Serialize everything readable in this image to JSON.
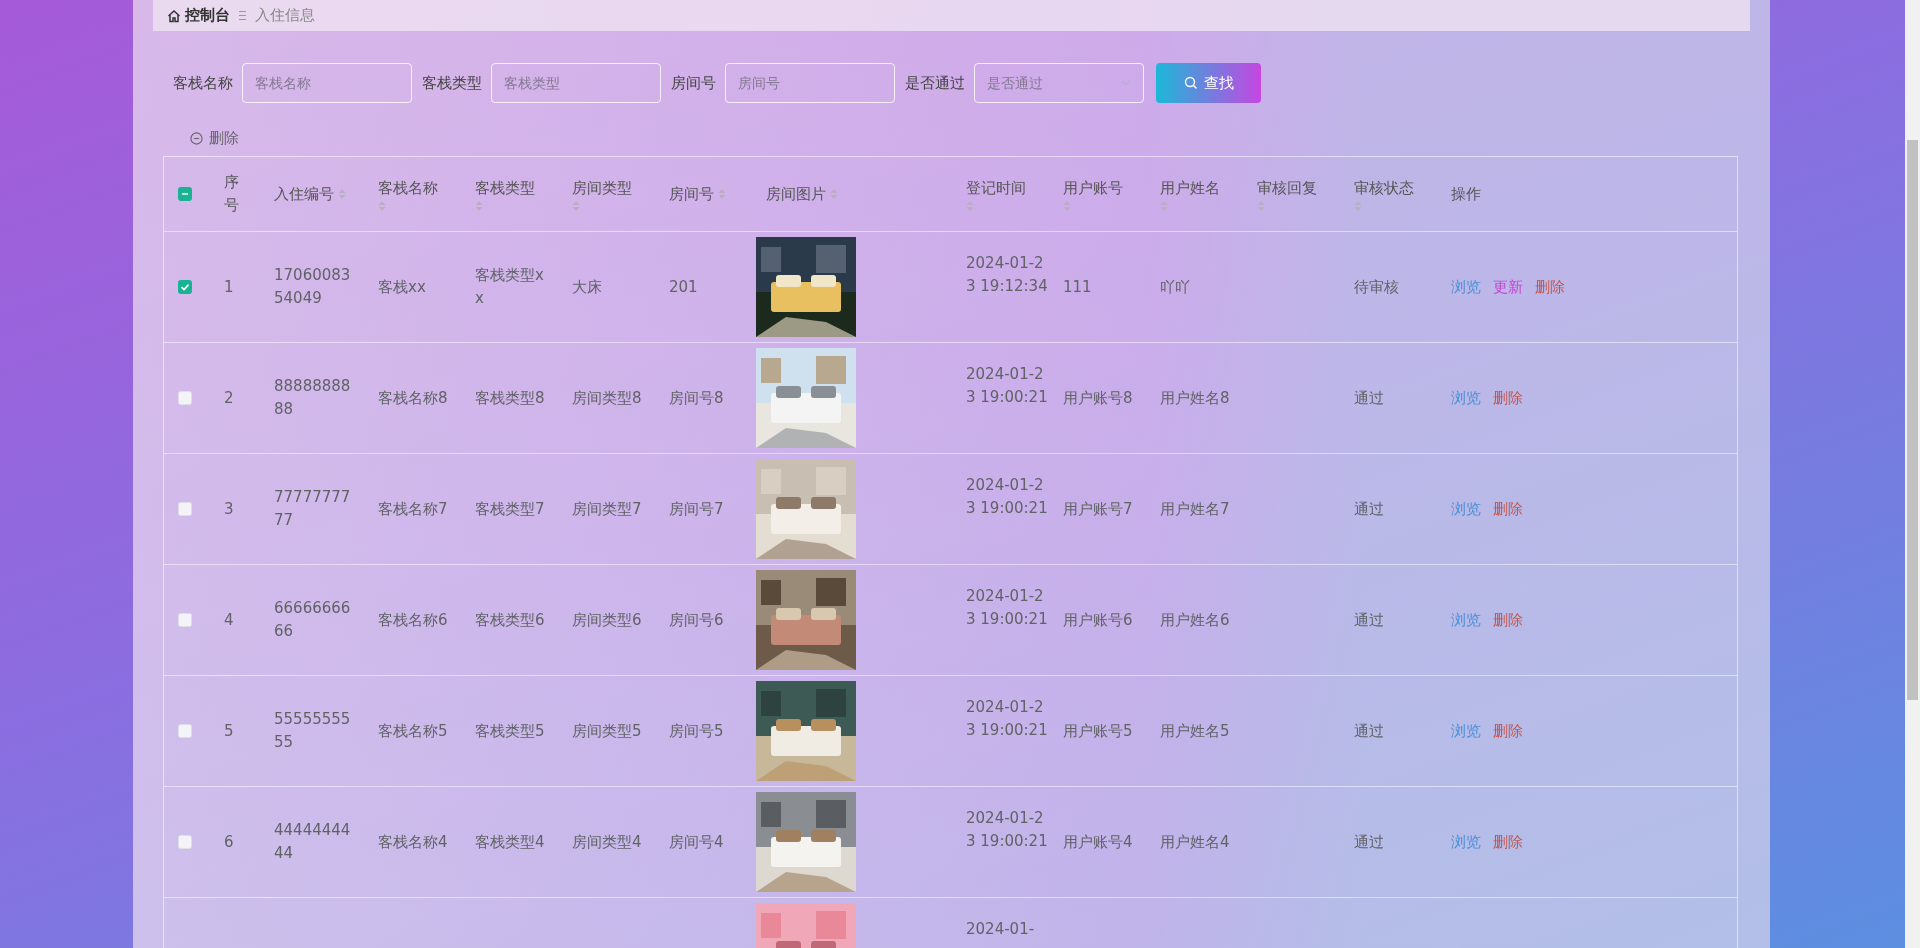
{
  "breadcrumb": {
    "home": "控制台",
    "current": "入住信息"
  },
  "filters": [
    {
      "label": "客栈名称",
      "placeholder": "客栈名称",
      "kind": "input"
    },
    {
      "label": "客栈类型",
      "placeholder": "客栈类型",
      "kind": "input"
    },
    {
      "label": "房间号",
      "placeholder": "房间号",
      "kind": "input"
    },
    {
      "label": "是否通过",
      "placeholder": "是否通过",
      "kind": "select"
    }
  ],
  "search_button": "查找",
  "delete_button": "删除",
  "table": {
    "header_checkbox": {
      "checked": false,
      "indeterminate": true
    },
    "columns": [
      {
        "label": "序号",
        "sortable": false
      },
      {
        "label": "入住编号",
        "sortable": true
      },
      {
        "label": "客栈名称",
        "sortable": true
      },
      {
        "label": "客栈类型",
        "sortable": true
      },
      {
        "label": "房间类型",
        "sortable": true
      },
      {
        "label": "房间号",
        "sortable": true
      },
      {
        "label": "房间图片",
        "sortable": true
      },
      {
        "label": "登记时间",
        "sortable": true
      },
      {
        "label": "用户账号",
        "sortable": true
      },
      {
        "label": "用户姓名",
        "sortable": true
      },
      {
        "label": "审核回复",
        "sortable": true
      },
      {
        "label": "审核状态",
        "sortable": true
      },
      {
        "label": "操作",
        "sortable": false
      }
    ],
    "rows": [
      {
        "checked": true,
        "index": "1",
        "number": "1706008354049",
        "inn_name": "客栈xx",
        "inn_type": "客栈类型xx",
        "room_type": "大床",
        "room_no": "201",
        "picture": {
          "kind": "picture"
        },
        "time": "2024-01-23 19:12:34",
        "account": "111",
        "user_name": "吖吖",
        "status": "待审核",
        "actions": [
          {
            "label": "浏览",
            "kind": "view"
          },
          {
            "label": "更新",
            "kind": "update"
          },
          {
            "label": "删除",
            "kind": "delete"
          }
        ]
      },
      {
        "checked": false,
        "index": "2",
        "number": "8888888888",
        "inn_name": "客栈名称8",
        "inn_type": "客栈类型8",
        "room_type": "房间类型8",
        "room_no": "房间号8",
        "picture": {
          "kind": "picture"
        },
        "time": "2024-01-23 19:00:21",
        "account": "用户账号8",
        "user_name": "用户姓名8",
        "status": "通过",
        "actions": [
          {
            "label": "浏览",
            "kind": "view"
          },
          {
            "label": "删除",
            "kind": "delete"
          }
        ]
      },
      {
        "checked": false,
        "index": "3",
        "number": "7777777777",
        "inn_name": "客栈名称7",
        "inn_type": "客栈类型7",
        "room_type": "房间类型7",
        "room_no": "房间号7",
        "picture": {
          "kind": "picture"
        },
        "time": "2024-01-23 19:00:21",
        "account": "用户账号7",
        "user_name": "用户姓名7",
        "status": "通过",
        "actions": [
          {
            "label": "浏览",
            "kind": "view"
          },
          {
            "label": "删除",
            "kind": "delete"
          }
        ]
      },
      {
        "checked": false,
        "index": "4",
        "number": "6666666666",
        "inn_name": "客栈名称6",
        "inn_type": "客栈类型6",
        "room_type": "房间类型6",
        "room_no": "房间号6",
        "picture": {
          "kind": "picture"
        },
        "time": "2024-01-23 19:00:21",
        "account": "用户账号6",
        "user_name": "用户姓名6",
        "status": "通过",
        "actions": [
          {
            "label": "浏览",
            "kind": "view"
          },
          {
            "label": "删除",
            "kind": "delete"
          }
        ]
      },
      {
        "checked": false,
        "index": "5",
        "number": "5555555555",
        "inn_name": "客栈名称5",
        "inn_type": "客栈类型5",
        "room_type": "房间类型5",
        "room_no": "房间号5",
        "picture": {
          "kind": "picture"
        },
        "time": "2024-01-23 19:00:21",
        "account": "用户账号5",
        "user_name": "用户姓名5",
        "status": "通过",
        "actions": [
          {
            "label": "浏览",
            "kind": "view"
          },
          {
            "label": "删除",
            "kind": "delete"
          }
        ]
      },
      {
        "checked": false,
        "index": "6",
        "number": "4444444444",
        "inn_name": "客栈名称4",
        "inn_type": "客栈类型4",
        "room_type": "房间类型4",
        "room_no": "房间号4",
        "picture": {
          "kind": "picture"
        },
        "time": "2024-01-23 19:00:21",
        "account": "用户账号4",
        "user_name": "用户姓名4",
        "status": "通过",
        "actions": [
          {
            "label": "浏览",
            "kind": "view"
          },
          {
            "label": "删除",
            "kind": "delete"
          }
        ]
      },
      {
        "picture": {
          "kind": "picture"
        },
        "time": "2024-01-"
      }
    ]
  }
}
